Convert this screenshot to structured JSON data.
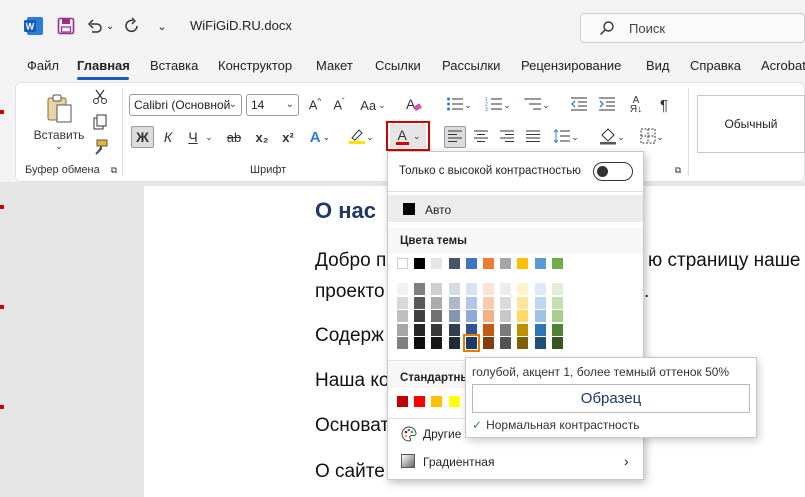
{
  "titlebar": {
    "doc_title": "WiFiGiD.RU.docx",
    "search_placeholder": "Поиск"
  },
  "tabs": [
    "Файл",
    "Главная",
    "Вставка",
    "Конструктор",
    "Макет",
    "Ссылки",
    "Рассылки",
    "Рецензирование",
    "Вид",
    "Справка",
    "Acrobat"
  ],
  "active_tab": "Главная",
  "ribbon": {
    "paste_label": "Вставить",
    "clipboard_group": "Буфер обмена",
    "font_group": "Шрифт",
    "font_name": "Calibri (Основной",
    "font_size": "14",
    "bold": "Ж",
    "italic": "К",
    "underline": "Ч",
    "strike": "ab",
    "subscript": "x₂",
    "superscript": "x²",
    "grow_font": "A^",
    "shrink_font": "Aˇ",
    "case": "Aa",
    "font_color_letter": "A",
    "style_normal": "Обычный"
  },
  "document": {
    "heading": "О нас",
    "lines": [
      {
        "text": "Добро п",
        "tail": "ю страницу наше"
      },
      {
        "text": "проекто",
        "tail": "."
      },
      {
        "text": "Содерж",
        "tail": ""
      },
      {
        "text": "Наша ко",
        "tail": ""
      },
      {
        "text": "Основат",
        "tail": ""
      },
      {
        "text": "О сайте",
        "tail": ""
      }
    ]
  },
  "dropdown": {
    "high_contrast_label": "Только с высокой контрастностью",
    "auto_label": "Авто",
    "theme_colors_label": "Цвета темы",
    "standard_colors_label": "Стандартные",
    "other_colors_label": "Другие",
    "gradient_label": "Градиентная",
    "theme_top_row": [
      "#ffffff",
      "#000000",
      "#e7e6e6",
      "#44546a",
      "#4472c4",
      "#ed7d31",
      "#a5a5a5",
      "#ffc000",
      "#5b9bd5",
      "#70ad47"
    ],
    "theme_shades": [
      [
        "#f2f2f2",
        "#d9d9d9",
        "#bfbfbf",
        "#a6a6a6",
        "#808080"
      ],
      [
        "#7f7f7f",
        "#595959",
        "#404040",
        "#262626",
        "#0d0d0d"
      ],
      [
        "#d0cece",
        "#aeabab",
        "#757171",
        "#3a3838",
        "#171616"
      ],
      [
        "#d6dce4",
        "#adb9ca",
        "#8496b0",
        "#333f4f",
        "#222a35"
      ],
      [
        "#d9e2f3",
        "#b4c6e7",
        "#8eaadb",
        "#2f5496",
        "#1f3864"
      ],
      [
        "#fbe4d5",
        "#f7cbac",
        "#f4b183",
        "#c55a11",
        "#833c0b"
      ],
      [
        "#ededed",
        "#dbdbdb",
        "#c9c9c9",
        "#7b7b7b",
        "#525252"
      ],
      [
        "#fff2cc",
        "#fee599",
        "#ffd965",
        "#bf8f00",
        "#7f6000"
      ],
      [
        "#deeaf6",
        "#bdd7ee",
        "#9cc3e5",
        "#2e75b5",
        "#1f4e79"
      ],
      [
        "#e2efd9",
        "#c5e0b3",
        "#a8d08d",
        "#538135",
        "#375623"
      ]
    ],
    "standard_colors": [
      "#c00000",
      "#ff0000",
      "#ffc000",
      "#ffff00",
      "#92d050"
    ]
  },
  "tooltip": {
    "title": "голубой, акцент 1, более темный оттенок 50%",
    "sample": "Образец",
    "contrast": "Нормальная контрастность"
  },
  "colors": {
    "accent": "#185abd",
    "highlight_frame": "#d00000",
    "heading": "#1f3864"
  }
}
